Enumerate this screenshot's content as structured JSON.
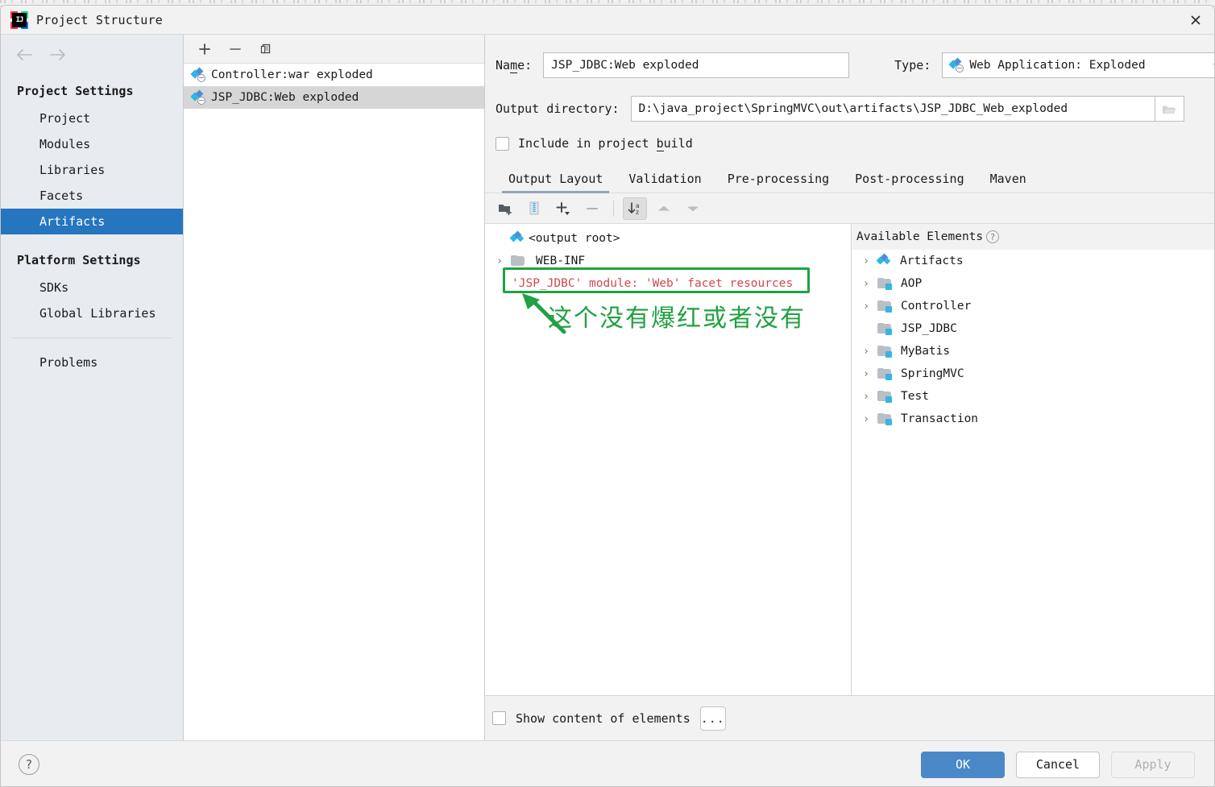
{
  "window": {
    "title": "Project Structure",
    "logo_label": "IJ",
    "close_icon": "close-icon"
  },
  "sidebar": {
    "nav": {
      "back_icon": "arrow-left-icon",
      "forward_icon": "arrow-right-icon"
    },
    "groups": [
      {
        "label": "Project Settings",
        "items": [
          {
            "label": "Project",
            "selected": false
          },
          {
            "label": "Modules",
            "selected": false
          },
          {
            "label": "Libraries",
            "selected": false
          },
          {
            "label": "Facets",
            "selected": false
          },
          {
            "label": "Artifacts",
            "selected": true
          }
        ]
      },
      {
        "label": "Platform Settings",
        "items": [
          {
            "label": "SDKs",
            "selected": false
          },
          {
            "label": "Global Libraries",
            "selected": false
          }
        ]
      }
    ],
    "extra_items": [
      {
        "label": "Problems",
        "selected": false
      }
    ]
  },
  "artifacts_panel": {
    "toolbar": [
      {
        "name": "add-artifact-button",
        "icon": "plus-icon"
      },
      {
        "name": "remove-artifact-button",
        "icon": "minus-icon"
      },
      {
        "name": "copy-artifact-button",
        "icon": "copy-icon"
      }
    ],
    "items": [
      {
        "label": "Controller:war exploded",
        "icon": "artifact-web-icon",
        "selected": false
      },
      {
        "label": "JSP_JDBC:Web exploded",
        "icon": "artifact-web-icon",
        "selected": true
      }
    ]
  },
  "form": {
    "name_label": "Name:",
    "name_label_mnemonic": "m",
    "name_value": "JSP_JDBC:Web exploded",
    "type_label": "Type:",
    "type_value": "Web Application: Exploded",
    "type_icon": "artifact-web-icon",
    "output_dir_label": "Output directory:",
    "output_dir_value": "D:\\java_project\\SpringMVC\\out\\artifacts\\JSP_JDBC_Web_exploded",
    "browse_icon": "folder-open-icon",
    "include_in_build_label_pre": "Include in project ",
    "include_in_build_mnemonic": "b",
    "include_in_build_label_post": "uild",
    "include_in_build_checked": false
  },
  "tabs": [
    {
      "label": "Output Layout",
      "active": true
    },
    {
      "label": "Validation",
      "active": false
    },
    {
      "label": "Pre-processing",
      "active": false
    },
    {
      "label": "Post-processing",
      "active": false
    },
    {
      "label": "Maven",
      "active": false
    }
  ],
  "layout_toolbar": [
    {
      "name": "create-directory-button",
      "icon": "folder-add-icon",
      "active": false
    },
    {
      "name": "create-archive-button",
      "icon": "archive-icon",
      "active": false
    },
    {
      "name": "add-copy-of-button",
      "icon": "plus-dropdown-icon",
      "active": false
    },
    {
      "name": "remove-element-button",
      "icon": "minus-icon",
      "active": false
    },
    {
      "name": "sort-elements-button",
      "icon": "sort-az-icon",
      "active": true
    },
    {
      "name": "move-up-button",
      "icon": "arrow-up-icon",
      "active": false
    },
    {
      "name": "move-down-button",
      "icon": "arrow-down-icon",
      "active": false
    }
  ],
  "output_tree": [
    {
      "label": "<output root>",
      "icon": "artifact-diamond-icon",
      "indent": 0,
      "twisty": "none",
      "error": false
    },
    {
      "label": "WEB-INF",
      "icon": "folder-icon",
      "indent": 0,
      "twisty": "collapsed",
      "error": false
    },
    {
      "label": "'JSP_JDBC' module: 'Web' facet resources",
      "icon": "none",
      "indent": 0,
      "twisty": "none",
      "error": true
    }
  ],
  "available_elements": {
    "title": "Available Elements",
    "help_icon": "help-icon",
    "items": [
      {
        "label": "Artifacts",
        "icon": "artifact-diamond-icon",
        "twisty": "collapsed"
      },
      {
        "label": "AOP",
        "icon": "module-folder-icon",
        "twisty": "collapsed"
      },
      {
        "label": "Controller",
        "icon": "module-folder-icon",
        "twisty": "collapsed"
      },
      {
        "label": "JSP_JDBC",
        "icon": "module-folder-icon",
        "twisty": "none"
      },
      {
        "label": "MyBatis",
        "icon": "module-folder-icon",
        "twisty": "collapsed"
      },
      {
        "label": "SpringMVC",
        "icon": "module-folder-icon",
        "twisty": "collapsed"
      },
      {
        "label": "Test",
        "icon": "module-folder-icon",
        "twisty": "collapsed"
      },
      {
        "label": "Transaction",
        "icon": "module-folder-icon",
        "twisty": "collapsed"
      }
    ]
  },
  "annotation": {
    "color": "#21a143",
    "text": "这个没有爆红或者没有",
    "arrow_icon": "annotation-arrow-icon",
    "box_target": "'JSP_JDBC' module: 'Web' facet resources"
  },
  "bottom_bar": {
    "show_content_label": "Show content of elements",
    "show_content_checked": false,
    "more_button_label": "...",
    "more_button_name": "show-content-options-button"
  },
  "footer": {
    "help_label": "?",
    "ok_label": "OK",
    "cancel_label": "Cancel",
    "apply_label": "Apply",
    "apply_disabled": true,
    "ok_color": "#4a88c7"
  }
}
